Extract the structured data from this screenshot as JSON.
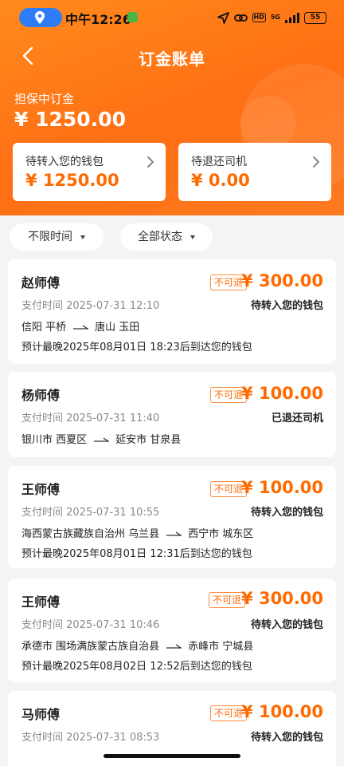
{
  "status_bar": {
    "time": "中午12:26",
    "network": "5G",
    "battery": "55",
    "hd_label": "HD"
  },
  "nav": {
    "title": "订金账单"
  },
  "summary": {
    "holding_label": "担保中订金",
    "holding_amount": "¥ 1250.00",
    "cards": [
      {
        "label": "待转入您的钱包",
        "amount": "¥ 1250.00"
      },
      {
        "label": "待退还司机",
        "amount": "¥ 0.00"
      }
    ]
  },
  "filters": {
    "time": "不限时间",
    "status": "全部状态"
  },
  "records": [
    {
      "name": "赵师傅",
      "badge": "不可退",
      "amount": "¥ 300.00",
      "pay_time": "支付时间 2025-07-31 12:10",
      "state": "待转入您的钱包",
      "from": "信阳 平桥",
      "to": "唐山 玉田",
      "eta": "预计最晚2025年08月01日 18:23后到达您的钱包"
    },
    {
      "name": "杨师傅",
      "badge": "不可退",
      "amount": "¥ 100.00",
      "pay_time": "支付时间 2025-07-31 11:40",
      "state": "已退还司机",
      "from": "银川市 西夏区",
      "to": "延安市 甘泉县",
      "eta": ""
    },
    {
      "name": "王师傅",
      "badge": "不可退",
      "amount": "¥ 100.00",
      "pay_time": "支付时间 2025-07-31 10:55",
      "state": "待转入您的钱包",
      "from": "海西蒙古族藏族自治州 乌兰县",
      "to": "西宁市 城东区",
      "eta": "预计最晚2025年08月01日 12:31后到达您的钱包"
    },
    {
      "name": "王师傅",
      "badge": "不可退",
      "amount": "¥ 300.00",
      "pay_time": "支付时间 2025-07-31 10:46",
      "state": "待转入您的钱包",
      "from": "承德市 围场满族蒙古族自治县",
      "to": "赤峰市 宁城县",
      "eta": "预计最晚2025年08月02日 12:52后到达您的钱包"
    },
    {
      "name": "马师傅",
      "badge": "不可退",
      "amount": "¥ 100.00",
      "pay_time": "支付时间 2025-07-31 08:53",
      "state": "待转入您的钱包",
      "from": "",
      "to": "",
      "eta": ""
    }
  ],
  "colors": {
    "accent": "#ff6a00",
    "header": "#ff7a1c",
    "location_pill": "#2f7df6"
  }
}
